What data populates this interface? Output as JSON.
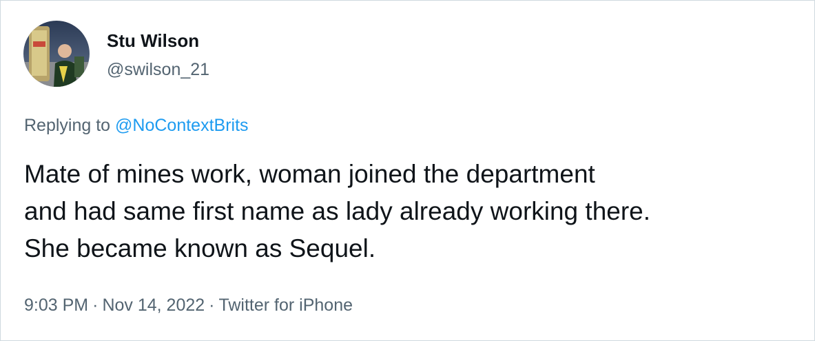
{
  "author": {
    "name": "Stu Wilson",
    "handle": "@swilson_21"
  },
  "reply": {
    "prefix": "Replying to",
    "mention": "@NoContextBrits"
  },
  "tweet": {
    "lines": [
      "Mate of mines work, woman joined the department",
      "and had same first name as lady already working there.",
      "She became known as Sequel."
    ]
  },
  "meta": {
    "time": "9:03 PM",
    "separator": "·",
    "date": "Nov 14, 2022",
    "source": "Twitter for iPhone"
  },
  "colors": {
    "text": "#0f1419",
    "secondary": "#536471",
    "link": "#1d9bf0",
    "border": "#cfd9de"
  }
}
